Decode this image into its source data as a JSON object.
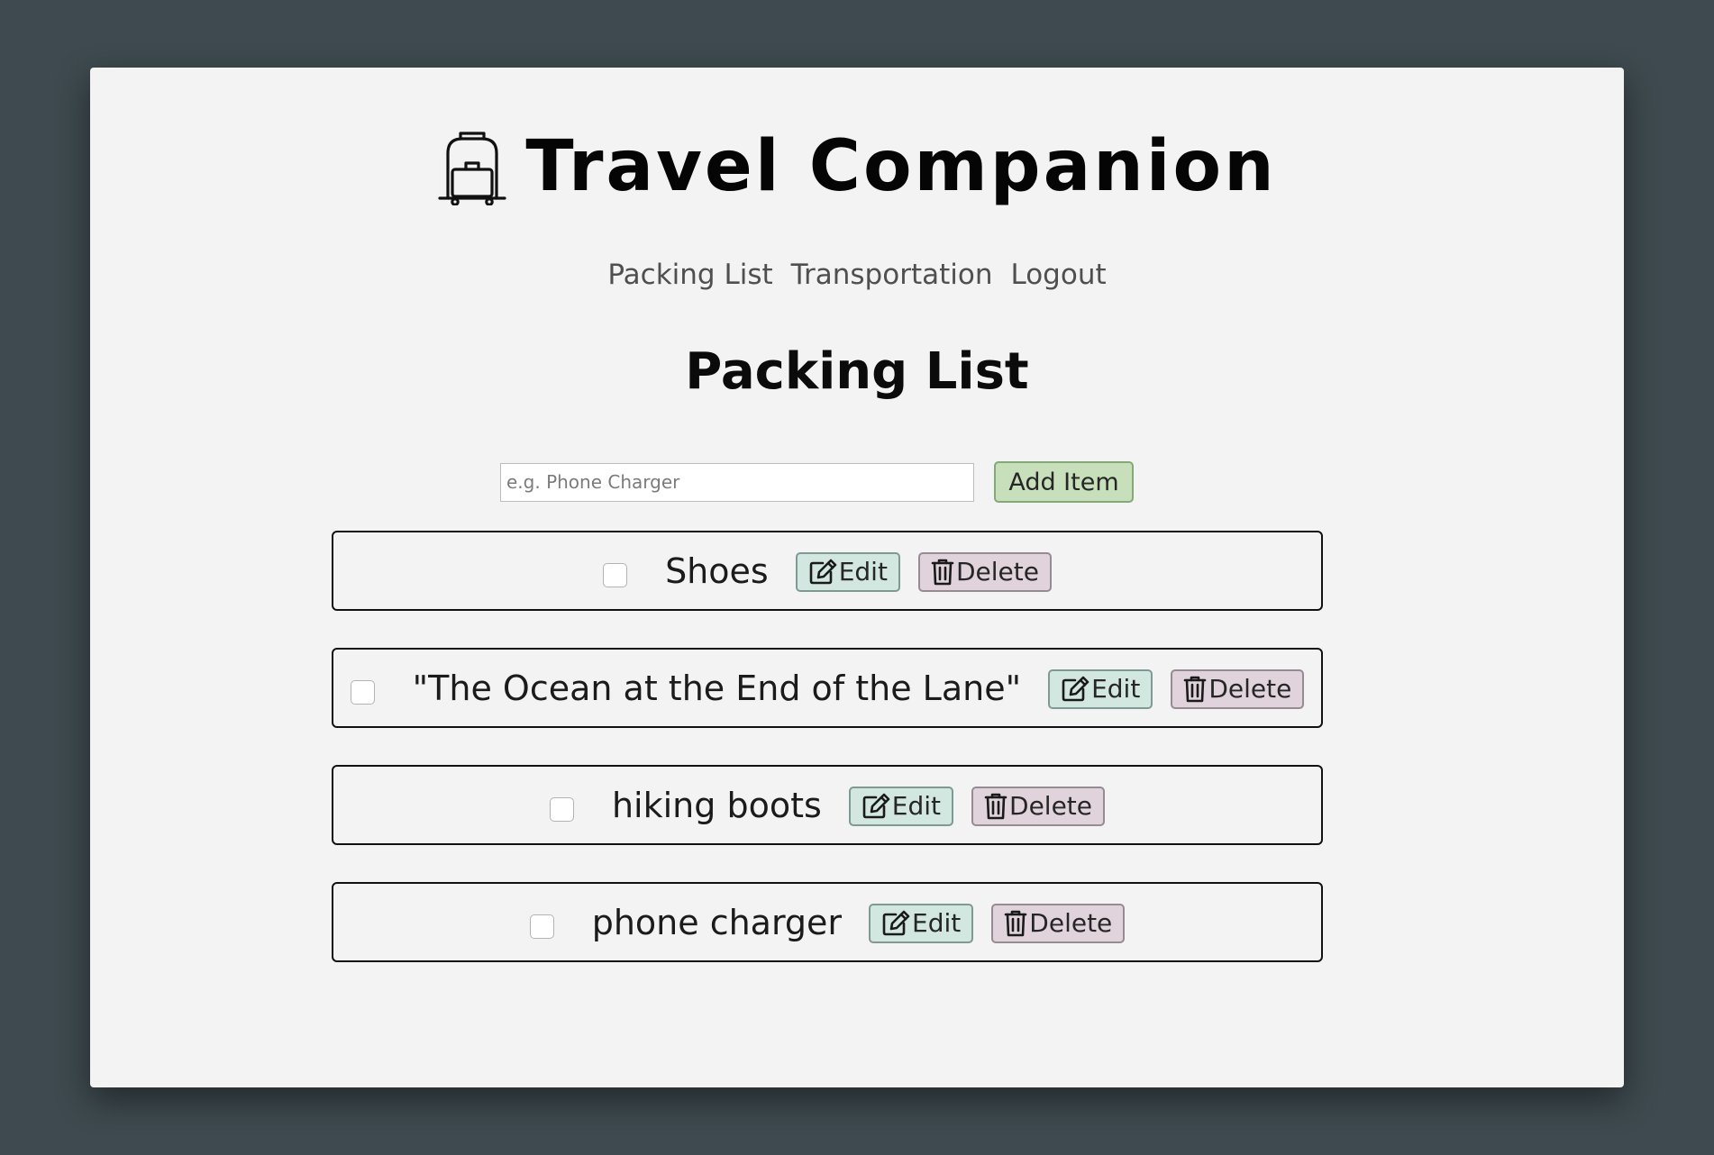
{
  "app": {
    "title": "Travel Companion",
    "logo_icon": "luggage-cart-icon"
  },
  "nav": {
    "items": [
      {
        "label": "Packing List"
      },
      {
        "label": "Transportation"
      },
      {
        "label": "Logout"
      }
    ]
  },
  "page": {
    "title": "Packing List"
  },
  "add_form": {
    "placeholder": "e.g. Phone Charger",
    "value": "",
    "button_label": "Add Item"
  },
  "items": [
    {
      "name": "Shoes",
      "checked": false,
      "edit_label": "Edit",
      "delete_label": "Delete"
    },
    {
      "name": "\"The Ocean at the End of the Lane\"",
      "checked": false,
      "edit_label": "Edit",
      "delete_label": "Delete"
    },
    {
      "name": "hiking boots",
      "checked": false,
      "edit_label": "Edit",
      "delete_label": "Delete"
    },
    {
      "name": "phone charger",
      "checked": false,
      "edit_label": "Edit",
      "delete_label": "Delete"
    }
  ],
  "icons": {
    "edit": "pencil-square-icon",
    "delete": "trash-icon"
  },
  "colors": {
    "background": "#3e4a4f",
    "card": "#f3f3f3",
    "add_button": "#c8dfbb",
    "edit_button": "#d3e7e1",
    "delete_button": "#e0d3dc"
  }
}
